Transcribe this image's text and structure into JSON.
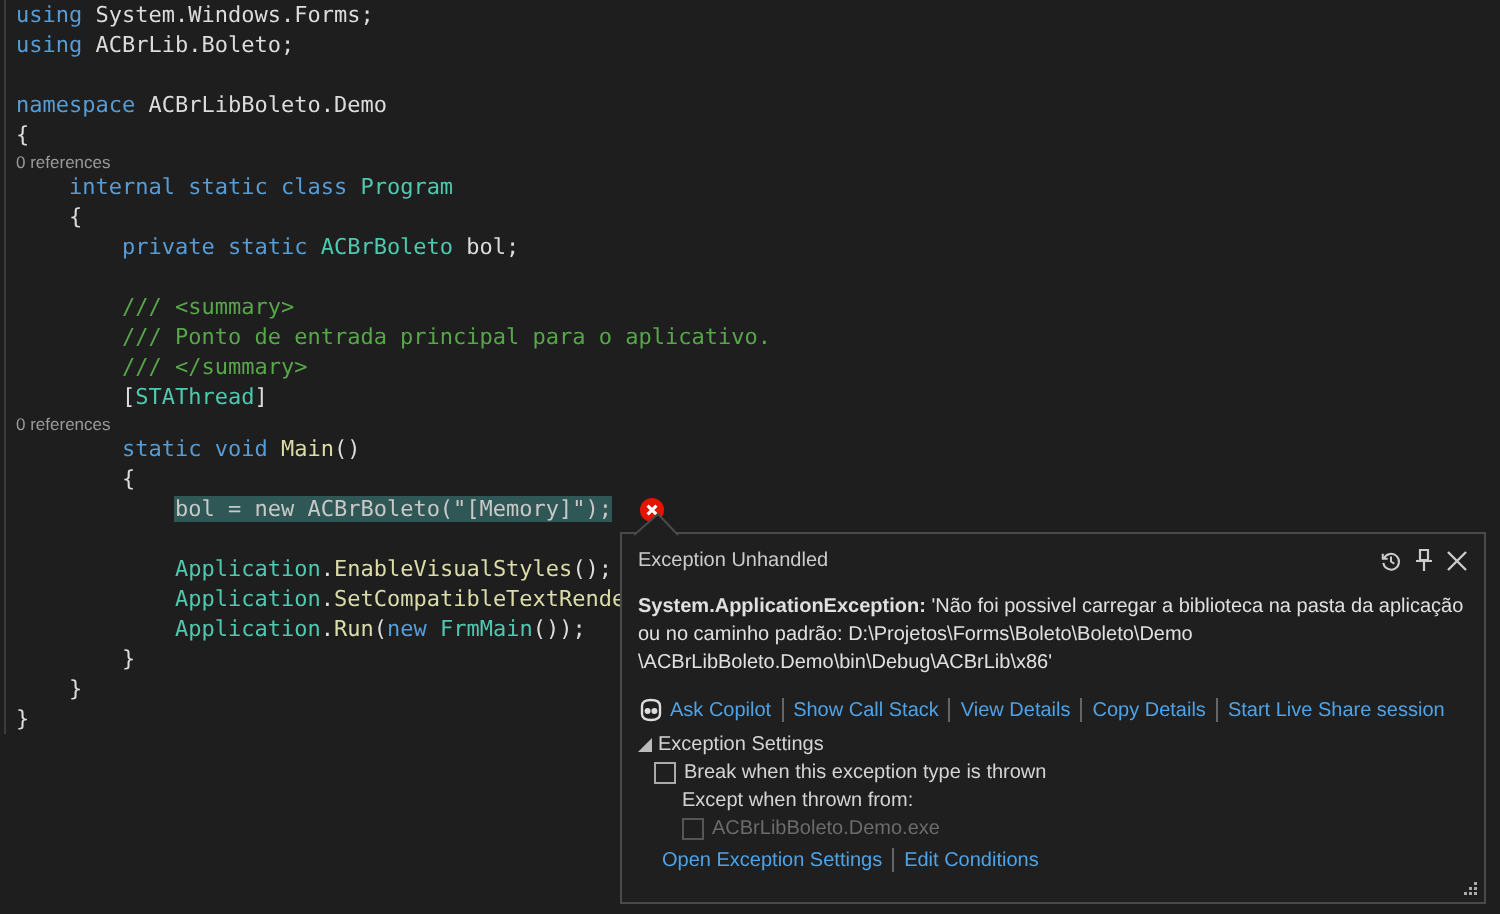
{
  "editor": {
    "lines": [
      {
        "kind": "code",
        "tokens": [
          {
            "kind": "keyword",
            "text": "using"
          },
          {
            "kind": "plain",
            "text": " System.Windows.Forms;"
          }
        ]
      },
      {
        "kind": "code",
        "tokens": [
          {
            "kind": "keyword",
            "text": "using"
          },
          {
            "kind": "plain",
            "text": " ACBrLib.Boleto;"
          }
        ]
      },
      {
        "kind": "blank"
      },
      {
        "kind": "code",
        "tokens": [
          {
            "kind": "keyword",
            "text": "namespace"
          },
          {
            "kind": "plain",
            "text": " ACBrLibBoleto.Demo"
          }
        ]
      },
      {
        "kind": "code",
        "tokens": [
          {
            "kind": "plain",
            "text": "{"
          }
        ]
      },
      {
        "kind": "lens",
        "text": "0 references"
      },
      {
        "kind": "code",
        "tokens": [
          {
            "kind": "keyword",
            "text": "    internal static class"
          },
          {
            "kind": "type",
            "text": " Program"
          }
        ]
      },
      {
        "kind": "code",
        "tokens": [
          {
            "kind": "plain",
            "text": "    {"
          }
        ]
      },
      {
        "kind": "code",
        "tokens": [
          {
            "kind": "keyword",
            "text": "        private static"
          },
          {
            "kind": "type",
            "text": " ACBrBoleto"
          },
          {
            "kind": "plain",
            "text": " bol;"
          }
        ]
      },
      {
        "kind": "blank"
      },
      {
        "kind": "code",
        "tokens": [
          {
            "kind": "comment",
            "text": "        /// <summary>"
          }
        ]
      },
      {
        "kind": "code",
        "tokens": [
          {
            "kind": "comment",
            "text": "        /// Ponto de entrada principal para o aplicativo."
          }
        ]
      },
      {
        "kind": "code",
        "tokens": [
          {
            "kind": "comment",
            "text": "        /// </summary>"
          }
        ]
      },
      {
        "kind": "code",
        "tokens": [
          {
            "kind": "plain",
            "text": "        ["
          },
          {
            "kind": "type",
            "text": "STAThread"
          },
          {
            "kind": "plain",
            "text": "]"
          }
        ]
      },
      {
        "kind": "lens",
        "text": "0 references"
      },
      {
        "kind": "code",
        "tokens": [
          {
            "kind": "keyword",
            "text": "        static void"
          },
          {
            "kind": "method",
            "text": " Main"
          },
          {
            "kind": "plain",
            "text": "()"
          }
        ]
      },
      {
        "kind": "code",
        "tokens": [
          {
            "kind": "plain",
            "text": "        {"
          }
        ]
      },
      {
        "kind": "code",
        "current": true,
        "tokens": [
          {
            "kind": "plain",
            "text": "            bol = new ACBrBoleto(\"[Memory]\");"
          }
        ]
      },
      {
        "kind": "blank"
      },
      {
        "kind": "code",
        "tokens": [
          {
            "kind": "type",
            "text": "            Application"
          },
          {
            "kind": "plain",
            "text": "."
          },
          {
            "kind": "method",
            "text": "EnableVisualStyles"
          },
          {
            "kind": "plain",
            "text": "();"
          }
        ]
      },
      {
        "kind": "code",
        "tokens": [
          {
            "kind": "type",
            "text": "            Application"
          },
          {
            "kind": "plain",
            "text": "."
          },
          {
            "kind": "method",
            "text": "SetCompatibleTextRende"
          }
        ]
      },
      {
        "kind": "code",
        "tokens": [
          {
            "kind": "type",
            "text": "            Application"
          },
          {
            "kind": "plain",
            "text": "."
          },
          {
            "kind": "method",
            "text": "Run"
          },
          {
            "kind": "plain",
            "text": "("
          },
          {
            "kind": "keyword",
            "text": "new"
          },
          {
            "kind": "type",
            "text": " FrmMain"
          },
          {
            "kind": "plain",
            "text": "());"
          }
        ]
      },
      {
        "kind": "code",
        "tokens": [
          {
            "kind": "plain",
            "text": "        }"
          }
        ]
      },
      {
        "kind": "code",
        "tokens": [
          {
            "kind": "plain",
            "text": "    }"
          }
        ]
      },
      {
        "kind": "code",
        "tokens": [
          {
            "kind": "plain",
            "text": "}"
          }
        ]
      }
    ]
  },
  "exception_popup": {
    "title": "Exception Unhandled",
    "message": "**System.ApplicationException:** 'Não foi possivel carregar a biblioteca na pasta da aplicação ou no caminho padrão: D:\\Projetos\\Forms\\Boleto\\Boleto\\Demo \\ACBrLibBoleto.Demo\\bin\\Debug\\ACBrLib\\x86'",
    "actions": [
      "Ask Copilot",
      "Show Call Stack",
      "View Details",
      "Copy Details",
      "Start Live Share session"
    ],
    "settings": {
      "title": "Exception Settings",
      "expanded": true,
      "options": [
        {
          "label": "Break when this exception type is thrown",
          "checked": false,
          "disabled": false
        },
        {
          "kind": "heading",
          "label": "Except when thrown from:"
        },
        {
          "label": "ACBrLibBoleto.Demo.exe",
          "checked": false,
          "disabled": true
        }
      ]
    },
    "links": [
      "Open Exception Settings",
      "Edit Conditions"
    ]
  }
}
